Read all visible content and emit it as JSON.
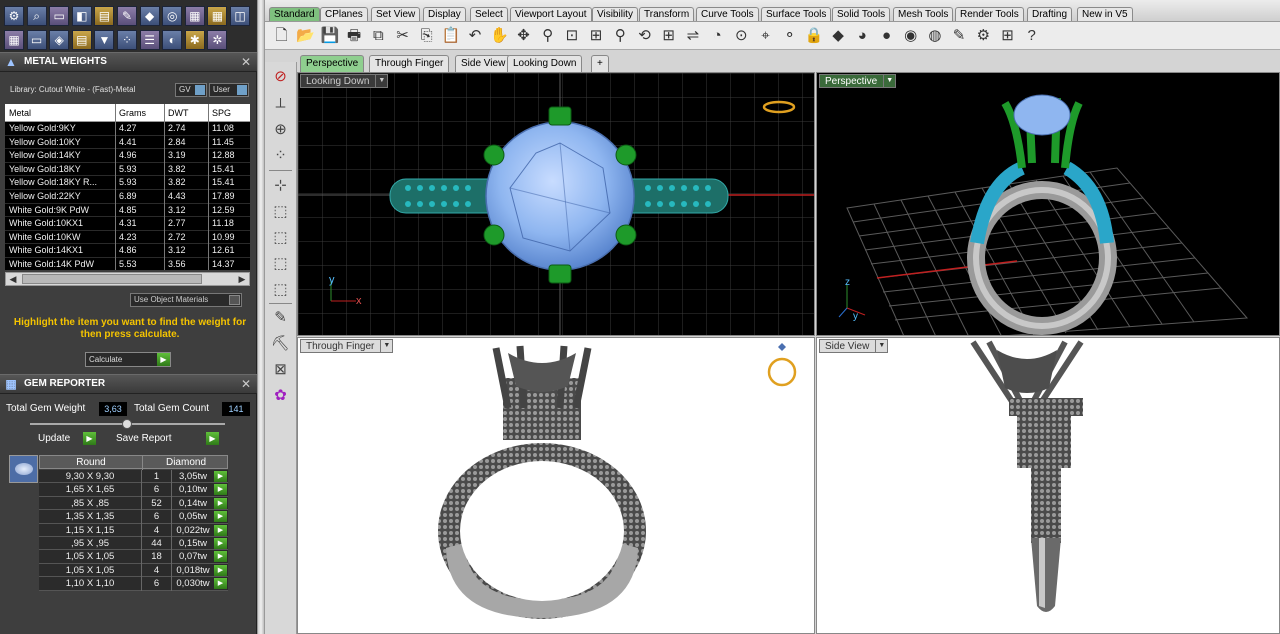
{
  "left_toolbar": {
    "icons": [
      "settings-icon",
      "search-icon",
      "layers-icon",
      "box-icon",
      "slab-icon",
      "edit-icon",
      "cube-icon",
      "ring-icon",
      "frame-icon",
      "frame-icon",
      "render-icon",
      "grid-icon",
      "pane-icon",
      "box3d-icon",
      "layers2-icon",
      "funnel-icon",
      "scatter-icon",
      "list-icon",
      "stone-icon",
      "star-icon",
      "star2-icon"
    ]
  },
  "metal_weights": {
    "title": "METAL WEIGHTS",
    "library_label": "Library: Cutout White - (Fast)-Metal",
    "gv_label": "GV",
    "user_label": "User",
    "columns": [
      "Metal",
      "Grams",
      "DWT",
      "SPG"
    ],
    "rows": [
      {
        "metal": "Yellow Gold:9KY",
        "grams": "4.27",
        "dwt": "2.74",
        "spg": "11.08"
      },
      {
        "metal": "Yellow Gold:10KY",
        "grams": "4.41",
        "dwt": "2.84",
        "spg": "11.45"
      },
      {
        "metal": "Yellow Gold:14KY",
        "grams": "4.96",
        "dwt": "3.19",
        "spg": "12.88"
      },
      {
        "metal": "Yellow Gold:18KY",
        "grams": "5.93",
        "dwt": "3.82",
        "spg": "15.41"
      },
      {
        "metal": "Yellow Gold:18KY R...",
        "grams": "5.93",
        "dwt": "3.82",
        "spg": "15.41"
      },
      {
        "metal": "Yellow Gold:22KY",
        "grams": "6.89",
        "dwt": "4.43",
        "spg": "17.89"
      },
      {
        "metal": "White Gold:9K PdW",
        "grams": "4.85",
        "dwt": "3.12",
        "spg": "12.59"
      },
      {
        "metal": "White Gold:10KX1",
        "grams": "4.31",
        "dwt": "2.77",
        "spg": "11.18"
      },
      {
        "metal": "White Gold:10KW",
        "grams": "4.23",
        "dwt": "2.72",
        "spg": "10.99"
      },
      {
        "metal": "White Gold:14KX1",
        "grams": "4.86",
        "dwt": "3.12",
        "spg": "12.61"
      },
      {
        "metal": "White Gold:14K PdW",
        "grams": "5.53",
        "dwt": "3.56",
        "spg": "14.37"
      }
    ],
    "use_object_materials": "Use Object Materials",
    "hint": "Highlight the item you want to find the weight for then press calculate.",
    "calculate": "Calculate"
  },
  "gem_reporter": {
    "title": "GEM REPORTER",
    "total_weight_label": "Total Gem Weight",
    "total_weight": "3,63",
    "total_count_label": "Total Gem Count",
    "total_count": "141",
    "update": "Update",
    "save_report": "Save Report",
    "shape_header": "Round",
    "type_header": "Diamond",
    "rows": [
      {
        "size": "9,30 X 9,30",
        "qty": "1",
        "tw": "3,05tw"
      },
      {
        "size": "1,65 X 1,65",
        "qty": "6",
        "tw": "0,10tw"
      },
      {
        "size": ",85 X ,85",
        "qty": "52",
        "tw": "0,14tw"
      },
      {
        "size": "1,35 X 1,35",
        "qty": "6",
        "tw": "0,05tw"
      },
      {
        "size": "1,15 X 1,15",
        "qty": "4",
        "tw": "0,022tw"
      },
      {
        "size": ",95 X ,95",
        "qty": "44",
        "tw": "0,15tw"
      },
      {
        "size": "1,05 X 1,05",
        "qty": "18",
        "tw": "0,07tw"
      },
      {
        "size": "1,05 X 1,05",
        "qty": "4",
        "tw": "0,018tw"
      },
      {
        "size": "1,10 X 1,10",
        "qty": "6",
        "tw": "0,030tw"
      }
    ]
  },
  "toolbar_tabs": [
    "Standard",
    "CPlanes",
    "Set View",
    "Display",
    "Select",
    "Viewport Layout",
    "Visibility",
    "Transform",
    "Curve Tools",
    "Surface Tools",
    "Solid Tools",
    "Mesh Tools",
    "Render Tools",
    "Drafting",
    "New in V5"
  ],
  "viewport_tabs": [
    "Perspective",
    "Through Finger",
    "Side View",
    "Looking Down"
  ],
  "viewports": {
    "top_left": "Looking Down",
    "top_right": "Perspective",
    "bottom_left": "Through Finger",
    "bottom_right": "Side View"
  },
  "axes": {
    "x": "x",
    "y": "y",
    "z": "z"
  },
  "colors": {
    "gem_blue": "#8fb6f0",
    "prong_green": "#1e9a2a",
    "accent_green": "#7fc07f",
    "hint_yellow": "#f5c400",
    "metal_gray": "#8a8a8a"
  }
}
